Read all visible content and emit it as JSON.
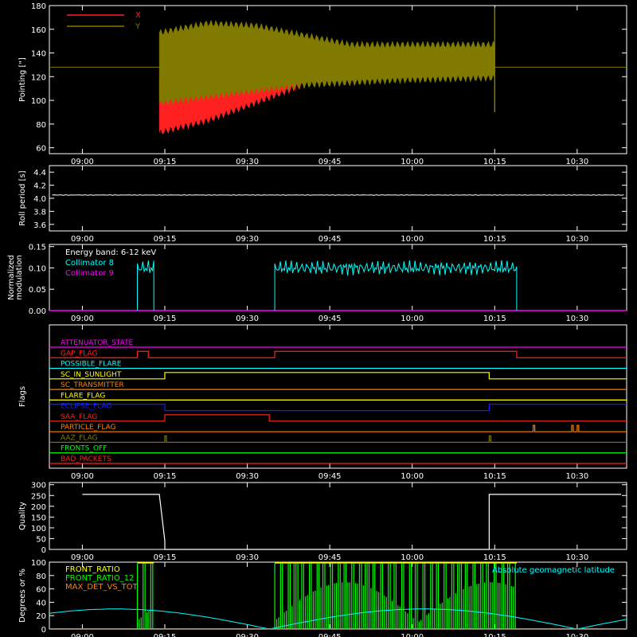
{
  "time_ticks": [
    "09:00",
    "09:15",
    "09:30",
    "09:45",
    "10:00",
    "10:15",
    "10:30"
  ],
  "colors": {
    "x": "#ff2020",
    "y": "#807a00",
    "white": "#ffffff",
    "cyan": "#00ffff",
    "magenta": "#ff00ff",
    "green": "#00ff00",
    "yellow": "#ffff00",
    "orange": "#ff8000",
    "blue": "#1020ff",
    "red": "#ff2020"
  },
  "chart_data": [
    {
      "id": "pointing",
      "type": "line",
      "ylabel": "Pointing [\"]",
      "ylim": [
        55,
        180
      ],
      "yticks": [
        60,
        80,
        100,
        120,
        140,
        160,
        180
      ],
      "legend": [
        "X",
        "Y"
      ],
      "reference_level": 128,
      "x_start": "09:14",
      "x_end": "10:15",
      "series": [
        {
          "name": "X",
          "band_min": [
            70,
            80,
            95,
            110,
            120,
            124,
            126,
            127
          ],
          "band_max": [
            120,
            135,
            140,
            145,
            146,
            148,
            148,
            147
          ]
        },
        {
          "name": "Y",
          "band_min": [
            95,
            100,
            105,
            110,
            112,
            114,
            115,
            116
          ],
          "band_max": [
            160,
            168,
            166,
            158,
            150,
            150,
            150,
            150
          ]
        }
      ]
    },
    {
      "id": "roll_period",
      "type": "line",
      "ylabel": "Roll period [s]",
      "ylim": [
        3.5,
        4.5
      ],
      "yticks": [
        3.6,
        3.8,
        4.0,
        4.2,
        4.4
      ],
      "value": 4.05
    },
    {
      "id": "modulation",
      "type": "line",
      "ylabel": [
        "Normalized",
        "modulation"
      ],
      "ylim": [
        0,
        0.155
      ],
      "yticks": [
        0.0,
        0.05,
        0.1,
        0.15
      ],
      "annotation": "Energy band: 6-12 keV",
      "legend": [
        "Collimator 8",
        "Collimator 9"
      ],
      "active_intervals": [
        [
          "09:10",
          "09:13"
        ],
        [
          "09:35",
          "10:19"
        ]
      ],
      "level": 0.1
    },
    {
      "id": "flags",
      "type": "line",
      "ylabel": "Flags",
      "rows": [
        {
          "name": "ATTENUATOR_STATE",
          "color": "magenta",
          "steps": []
        },
        {
          "name": "GAP_FLAG",
          "color": "red",
          "steps": [
            [
              "09:10",
              "09:12",
              1
            ],
            [
              "09:35",
              "10:19",
              1
            ]
          ]
        },
        {
          "name": "POSSIBLE_FLARE",
          "color": "cyan",
          "steps": []
        },
        {
          "name": "SC_IN_SUNLIGHT",
          "color": "yellow",
          "steps": [
            [
              "09:00",
              "09:15",
              0
            ],
            [
              "10:14",
              "10:38",
              0
            ]
          ]
        },
        {
          "name": "SC_TRANSMITTER",
          "color": "orange",
          "steps": []
        },
        {
          "name": "FLARE_FLAG",
          "color": "yellow",
          "steps": []
        },
        {
          "name": "ECLIPSE_FLAG",
          "color": "blue",
          "steps": [
            [
              "09:00",
              "09:15",
              1
            ],
            [
              "10:14",
              "10:38",
              1
            ]
          ]
        },
        {
          "name": "SAA_FLAG",
          "color": "red",
          "steps": [
            [
              "09:15",
              "09:34",
              1
            ]
          ]
        },
        {
          "name": "PARTICLE_FLAG",
          "color": "orange",
          "steps": [
            [
              "10:22",
              "10:22",
              1
            ],
            [
              "10:29",
              "10:29",
              1
            ],
            [
              "10:30",
              "10:30",
              1
            ]
          ]
        },
        {
          "name": "AAZ_FLAG",
          "color": "y",
          "steps": [
            [
              "09:15",
              "09:15",
              1
            ],
            [
              "10:14",
              "10:14",
              1
            ]
          ]
        },
        {
          "name": "FRONTS_OFF",
          "color": "green",
          "steps": []
        },
        {
          "name": "BAD_PACKETS",
          "color": "red",
          "steps": []
        }
      ]
    },
    {
      "id": "quality",
      "type": "line",
      "ylabel": "Quality",
      "ylim": [
        0,
        310
      ],
      "yticks": [
        0,
        50,
        100,
        150,
        200,
        250,
        300
      ],
      "high_value": 255,
      "high_intervals": [
        [
          "09:00",
          "09:14"
        ],
        [
          "10:14",
          "10:38"
        ]
      ]
    },
    {
      "id": "ratios",
      "type": "line",
      "ylabel": "Degrees or %",
      "ylim": [
        0,
        100
      ],
      "yticks": [
        0,
        20,
        40,
        60,
        80,
        100
      ],
      "legend_left": [
        "FRONT_RATIO",
        "FRONT_RATIO_12",
        "MAX_DET_VS_TOT"
      ],
      "legend_right": "Absolute geomagnetic latitude",
      "green_intervals": [
        [
          "09:10",
          "09:13"
        ],
        [
          "09:35",
          "10:19"
        ]
      ]
    }
  ]
}
